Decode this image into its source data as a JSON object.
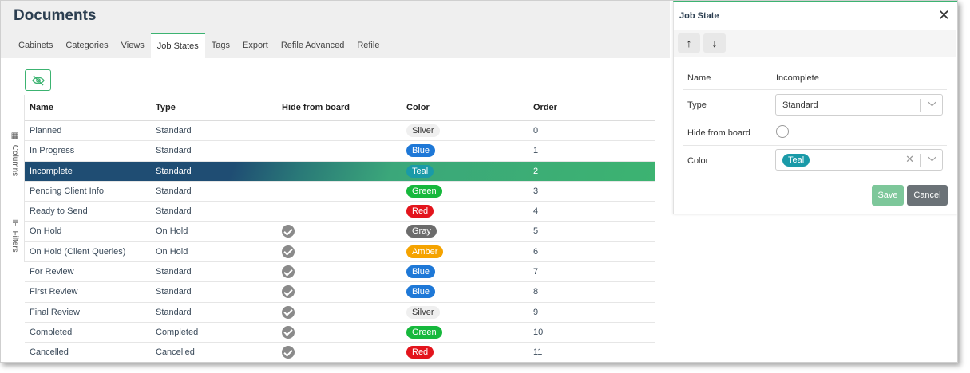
{
  "page": {
    "title": "Documents"
  },
  "tabs": [
    {
      "label": "Cabinets",
      "active": false
    },
    {
      "label": "Categories",
      "active": false
    },
    {
      "label": "Views",
      "active": false
    },
    {
      "label": "Job States",
      "active": true
    },
    {
      "label": "Tags",
      "active": false
    },
    {
      "label": "Export",
      "active": false
    },
    {
      "label": "Refile Advanced",
      "active": false
    },
    {
      "label": "Refile",
      "active": false
    }
  ],
  "siderail": {
    "columns_label": "Columns",
    "filters_label": "Filters"
  },
  "toolbar": {
    "visibility_icon": "eye-off-icon"
  },
  "table": {
    "headers": {
      "name": "Name",
      "type": "Type",
      "hide": "Hide from board",
      "color": "Color",
      "order": "Order"
    },
    "rows": [
      {
        "name": "Planned",
        "type": "Standard",
        "hide": false,
        "color": "Silver",
        "order": "0"
      },
      {
        "name": "In Progress",
        "type": "Standard",
        "hide": false,
        "color": "Blue",
        "order": "1"
      },
      {
        "name": "Incomplete",
        "type": "Standard",
        "hide": false,
        "color": "Teal",
        "order": "2",
        "selected": true
      },
      {
        "name": "Pending Client Info",
        "type": "Standard",
        "hide": false,
        "color": "Green",
        "order": "3"
      },
      {
        "name": "Ready to Send",
        "type": "Standard",
        "hide": false,
        "color": "Red",
        "order": "4"
      },
      {
        "name": "On Hold",
        "type": "On Hold",
        "hide": true,
        "color": "Gray",
        "order": "5"
      },
      {
        "name": "On Hold (Client Queries)",
        "type": "On Hold",
        "hide": true,
        "color": "Amber",
        "order": "6"
      },
      {
        "name": "For Review",
        "type": "Standard",
        "hide": true,
        "color": "Blue",
        "order": "7"
      },
      {
        "name": "First Review",
        "type": "Standard",
        "hide": true,
        "color": "Blue",
        "order": "8"
      },
      {
        "name": "Final Review",
        "type": "Standard",
        "hide": true,
        "color": "Silver",
        "order": "9"
      },
      {
        "name": "Completed",
        "type": "Completed",
        "hide": true,
        "color": "Green",
        "order": "10"
      },
      {
        "name": "Cancelled",
        "type": "Cancelled",
        "hide": true,
        "color": "Red",
        "order": "11"
      }
    ]
  },
  "colors": {
    "Silver": {
      "bg": "#efefef",
      "fg": "#333333"
    },
    "Blue": {
      "bg": "#1e78d7",
      "fg": "#ffffff"
    },
    "Teal": {
      "bg": "#1a9aa8",
      "fg": "#ffffff"
    },
    "Green": {
      "bg": "#16b83c",
      "fg": "#ffffff"
    },
    "Red": {
      "bg": "#e3141c",
      "fg": "#ffffff"
    },
    "Gray": {
      "bg": "#6c6c6c",
      "fg": "#ffffff"
    },
    "Amber": {
      "bg": "#f5a300",
      "fg": "#ffffff"
    },
    "accent": "#3cb371",
    "selected_row": "#1f4d73"
  },
  "panel": {
    "title": "Job State",
    "close_icon": "close-icon",
    "move_up_icon": "arrow-up-icon",
    "move_down_icon": "arrow-down-icon",
    "fields": {
      "name_label": "Name",
      "name_value": "Incomplete",
      "type_label": "Type",
      "type_value": "Standard",
      "hide_label": "Hide from board",
      "color_label": "Color",
      "color_value": "Teal"
    },
    "save_label": "Save",
    "cancel_label": "Cancel"
  }
}
